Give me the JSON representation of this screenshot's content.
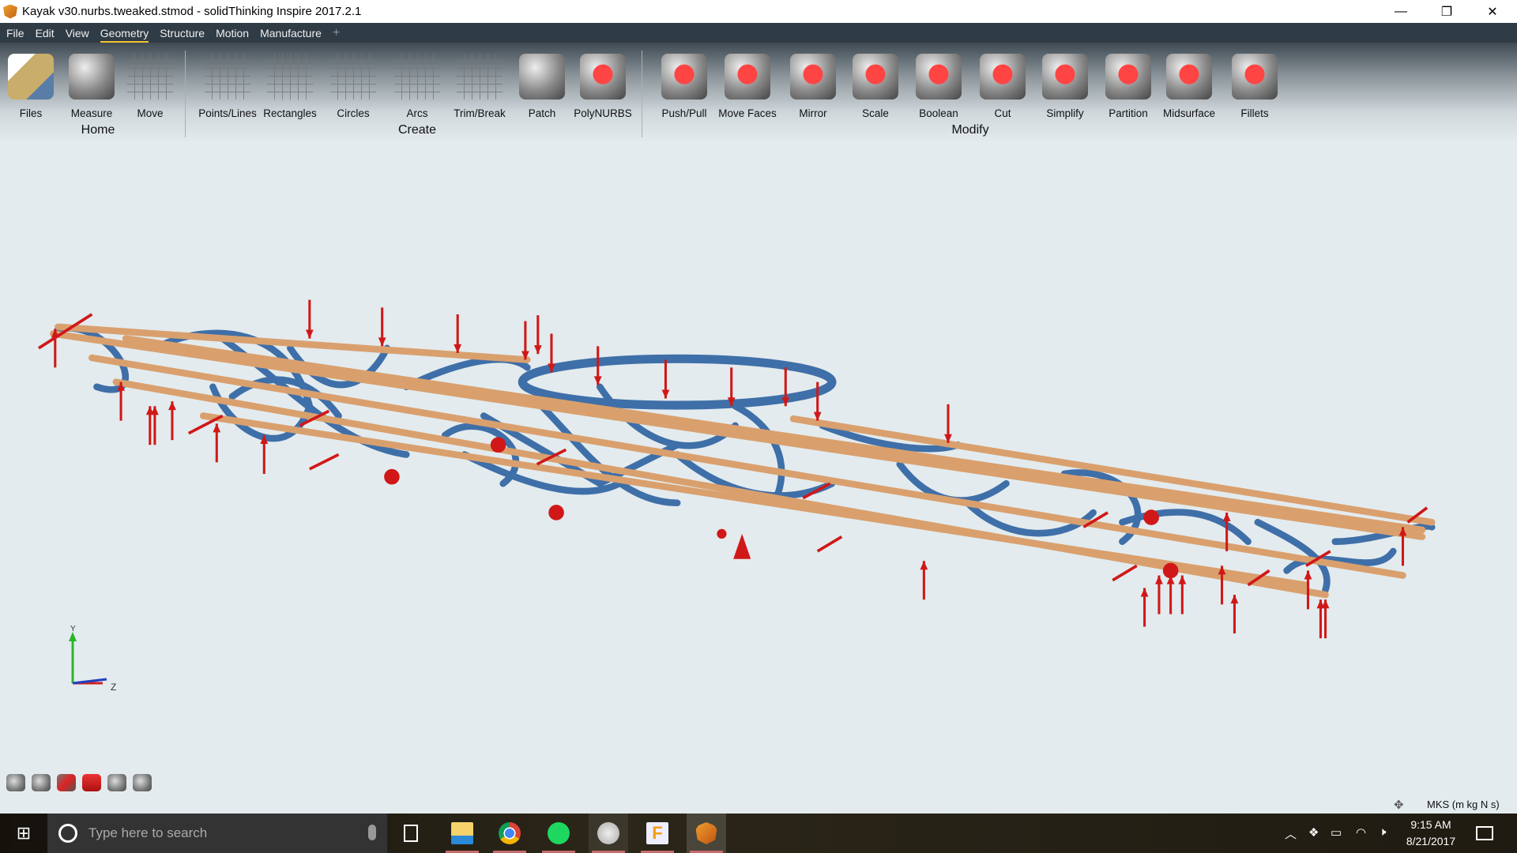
{
  "window": {
    "title": "Kayak v30.nurbs.tweaked.stmod - solidThinking Inspire 2017.2.1",
    "minimize": "—",
    "restore": "❐",
    "close": "✕"
  },
  "menu": {
    "items": [
      "File",
      "Edit",
      "View",
      "Geometry",
      "Structure",
      "Motion",
      "Manufacture"
    ],
    "active": "Geometry",
    "add": "+"
  },
  "ribbon": {
    "groups": {
      "home": "Home",
      "create": "Create",
      "modify": "Modify"
    },
    "tools": [
      "Files",
      "Measure",
      "Move",
      "Points/Lines",
      "Rectangles",
      "Circles",
      "Arcs",
      "Trim/Break",
      "Patch",
      "PolyNURBS",
      "Push/Pull",
      "Move Faces",
      "Mirror",
      "Scale",
      "Boolean",
      "Cut",
      "Simplify",
      "Partition",
      "Midsurface",
      "Fillets"
    ]
  },
  "viewport": {
    "axis": {
      "y": "Y",
      "z": "Z"
    },
    "colors": {
      "beam": "#d9a06e",
      "structure": "#3f6fa8",
      "load": "#d01818",
      "background": "#e3ebee"
    }
  },
  "view_tools": [
    "view-icon",
    "camera-icon",
    "section-icon",
    "shaded-icon",
    "zoom-icon",
    "3d-view-icon"
  ],
  "status": {
    "units": "MKS (m kg N s)"
  },
  "taskbar": {
    "search_placeholder": "Type here to search",
    "time": "9:15 AM",
    "date": "8/21/2017",
    "apps": [
      "task-view",
      "file-explorer",
      "chrome",
      "spotify",
      "compass-app",
      "autodesk-fusion",
      "solidthinking-inspire"
    ]
  }
}
